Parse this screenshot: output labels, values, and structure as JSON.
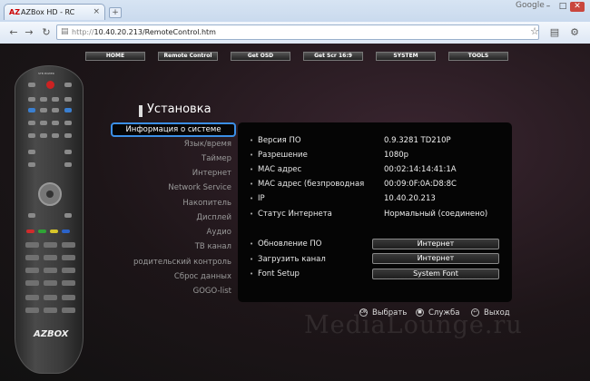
{
  "browser": {
    "tab_title": "AZBox HD - RC",
    "tab_favicon": "AZ",
    "tab_close": "×",
    "new_tab": "+",
    "top_right_label": "Google",
    "url_scheme": "http://",
    "url_rest": "10.40.20.213/RemoteControl.htm",
    "url_full": "http://10.40.20.213/RemoteControl.htm",
    "back_icon": "←",
    "forward_icon": "→",
    "reload_icon": "↻",
    "star_icon": "☆",
    "page_icon": "▤",
    "tools_icon": "⚙",
    "minimize": "–",
    "maximize": "□",
    "close": "✕"
  },
  "menu": {
    "items": [
      "HOME",
      "Remote Control",
      "Get OSD",
      "Get Scr 16:9",
      "SYSTEM",
      "TOOLS"
    ]
  },
  "remote": {
    "logo": "AZBOX",
    "top_label": "STB POWER"
  },
  "settings": {
    "title": "Установка",
    "sidebar": [
      "Информация о системе",
      "Язык/время",
      "Таймер",
      "Интернет",
      "Network Service",
      "Накопитель",
      "Дисплей",
      "Аудио",
      "ТВ канал",
      "родительский контроль",
      "Сброс данных",
      "GOGO-list"
    ],
    "selected_index": 0,
    "info_rows": [
      {
        "label": "Версия ПО",
        "value": "0.9.3281 TD210P"
      },
      {
        "label": "Разрешение",
        "value": "1080p"
      },
      {
        "label": "МАС адрес",
        "value": "00:02:14:14:41:1A"
      },
      {
        "label": "МАС адрес (безпроводная",
        "value": "00:09:0F:0A:D8:8C"
      },
      {
        "label": "IP",
        "value": "10.40.20.213"
      },
      {
        "label": "Статус Интернета",
        "value": "Нормальный (соединено)"
      }
    ],
    "action_rows": [
      {
        "label": "Обновление ПО",
        "button": "Интернет"
      },
      {
        "label": "Загрузить канал",
        "button": "Интернет"
      },
      {
        "label": "Font Setup",
        "button": "System Font"
      }
    ]
  },
  "hints": [
    {
      "icon": "OK",
      "label": "Выбрать"
    },
    {
      "icon": "■",
      "label": "Служба"
    },
    {
      "icon": "↩",
      "label": "Выход"
    }
  ],
  "watermark": "MediaLounge.ru"
}
